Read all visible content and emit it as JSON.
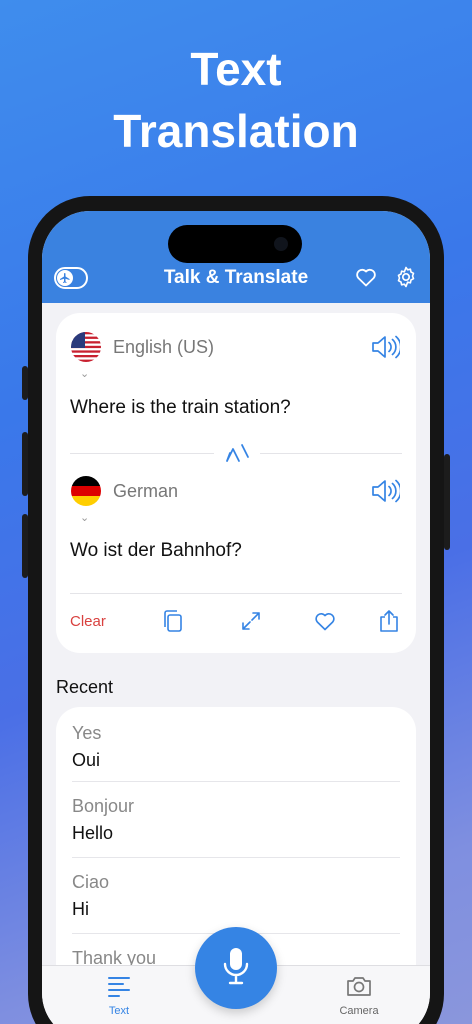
{
  "headline": {
    "line1": "Text",
    "line2": "Translation"
  },
  "header": {
    "title": "Talk & Translate",
    "icons": [
      "airplane-toggle-icon",
      "heart-icon",
      "gear-icon"
    ]
  },
  "translator": {
    "source": {
      "language": "English (US)",
      "flag": "us-flag-icon",
      "text": "Where is the train station?"
    },
    "target": {
      "language": "German",
      "flag": "germany-flag-icon",
      "text": "Wo ist der Bahnhof?"
    },
    "actions": {
      "clear_label": "Clear",
      "icons": [
        "copy-icon",
        "expand-icon",
        "heart-icon",
        "share-icon"
      ]
    }
  },
  "recent": {
    "label": "Recent",
    "items": [
      {
        "source": "Yes",
        "target": "Oui"
      },
      {
        "source": "Bonjour",
        "target": "Hello"
      },
      {
        "source": "Ciao",
        "target": "Hi"
      },
      {
        "source": "Thank you",
        "target": ""
      }
    ]
  },
  "tabbar": {
    "tabs": [
      {
        "label": "Text",
        "icon": "text-lines-icon",
        "active": true
      },
      {
        "label": "Camera",
        "icon": "camera-icon",
        "active": false
      }
    ]
  },
  "colors": {
    "brand": "#3a82e0",
    "accent": "#3584e4",
    "danger": "#d9413f"
  }
}
